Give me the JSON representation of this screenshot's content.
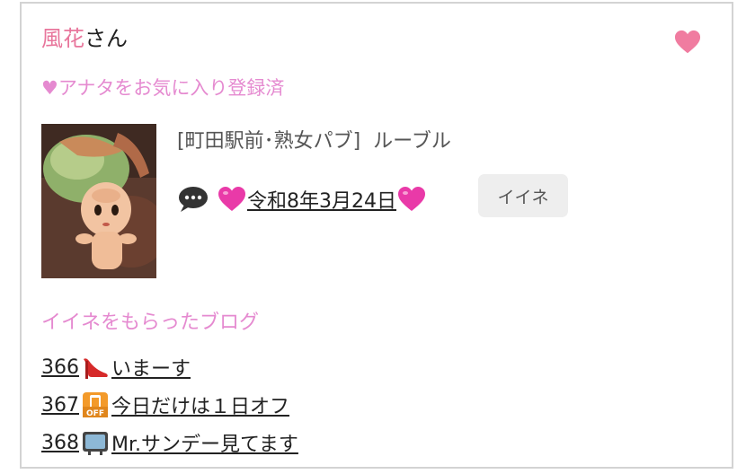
{
  "cast": {
    "name": "風花",
    "honorific": "さん",
    "favorite_status": "♥アナタをお気に入り登録済"
  },
  "shop": {
    "line": "[町田駅前･熟女パブ]  ルーブル"
  },
  "latest_blog": {
    "title": "令和8年3月24日",
    "like_label": "イイネ"
  },
  "liked_blogs": {
    "header": "イイネをもらったブログ",
    "items": [
      {
        "number": "366",
        "icon": "high-heel-icon",
        "title": "いまーす"
      },
      {
        "number": "367",
        "icon": "off-icon",
        "title": "今日だけは１日オフ"
      },
      {
        "number": "368",
        "icon": "television-icon",
        "title": "Mr.サンデー見てます"
      }
    ]
  },
  "colors": {
    "pink_name": "#e8769c",
    "pink_text": "#e58ad0",
    "heart": "#f07ca0",
    "emoji_heart": "#e93aa8"
  }
}
